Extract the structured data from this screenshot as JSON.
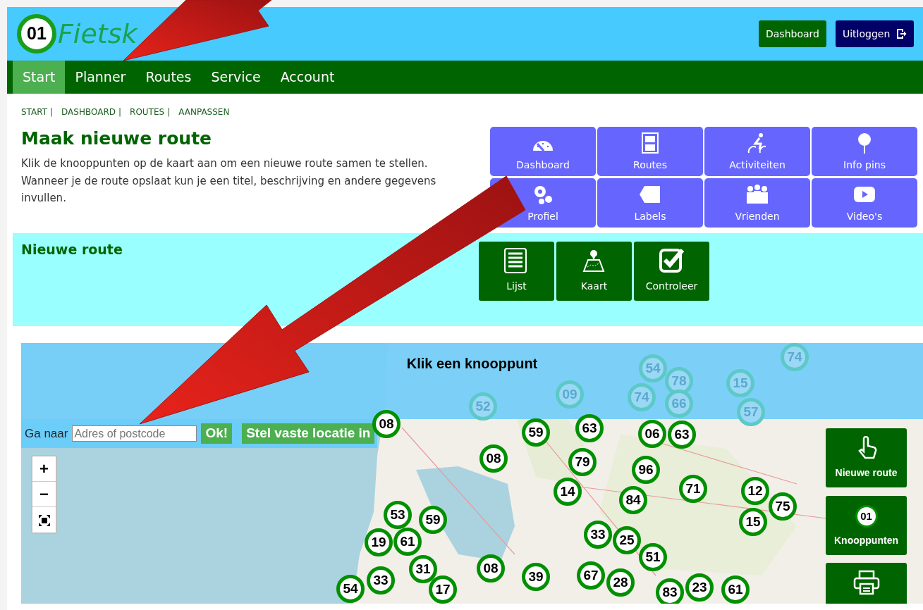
{
  "header": {
    "logo": {
      "badge": "01",
      "text": "Fietsk"
    },
    "buttons": [
      {
        "label": "Dashboard",
        "kind": "dashboard"
      },
      {
        "label": "Uitloggen",
        "kind": "logout"
      }
    ]
  },
  "nav": [
    {
      "label": "Start",
      "selected": true
    },
    {
      "label": "Planner",
      "selected": false
    },
    {
      "label": "Routes",
      "selected": false
    },
    {
      "label": "Service",
      "selected": false
    },
    {
      "label": "Account",
      "selected": false
    }
  ],
  "breadcrumb": {
    "items": [
      "START",
      "DASHBOARD",
      "ROUTES",
      "AANPASSEN"
    ],
    "separator": "|"
  },
  "title": "Maak nieuwe route",
  "intro": "Klik de knooppunten op de kaart aan om een nieuwe route samen te stellen. Wanneer je de route opslaat kun je een titel, beschrijving en andere gegevens invullen.",
  "tiles": [
    {
      "label": "Dashboard"
    },
    {
      "label": "Routes"
    },
    {
      "label": "Activiteiten"
    },
    {
      "label": "Info pins"
    },
    {
      "label": "Profiel"
    },
    {
      "label": "Labels"
    },
    {
      "label": "Vrienden"
    },
    {
      "label": "Video's"
    }
  ],
  "panel": {
    "title": "Nieuwe route",
    "buttons": [
      {
        "label": "Lijst"
      },
      {
        "label": "Kaart"
      },
      {
        "label": "Controleer"
      }
    ]
  },
  "map": {
    "title": "Klik een knooppunt",
    "search": {
      "label": "Ga naar",
      "placeholder": "Adres of postcode",
      "submit": "Ok!",
      "fixed_location": "Stel vaste locatie in"
    },
    "zoom": [
      "+",
      "−"
    ],
    "side_buttons": [
      {
        "label": "Nieuwe route"
      },
      {
        "label": "Knooppunten",
        "badge": "01"
      }
    ],
    "markers": [
      {
        "label": "54",
        "faded": true
      },
      {
        "label": "78",
        "faded": true
      },
      {
        "label": "15",
        "faded": true
      },
      {
        "label": "74",
        "faded": true
      },
      {
        "label": "52",
        "faded": true
      },
      {
        "label": "09",
        "faded": true
      },
      {
        "label": "74",
        "faded": true
      },
      {
        "label": "66",
        "faded": true
      },
      {
        "label": "57",
        "faded": true
      },
      {
        "label": "08",
        "faded": false
      },
      {
        "label": "59",
        "faded": false
      },
      {
        "label": "63",
        "faded": false
      },
      {
        "label": "06",
        "faded": false
      },
      {
        "label": "63",
        "faded": false
      },
      {
        "label": "08",
        "faded": false
      },
      {
        "label": "79",
        "faded": false
      },
      {
        "label": "96",
        "faded": false
      },
      {
        "label": "14",
        "faded": false
      },
      {
        "label": "84",
        "faded": false
      },
      {
        "label": "71",
        "faded": false
      },
      {
        "label": "12",
        "faded": false
      },
      {
        "label": "75",
        "faded": false
      },
      {
        "label": "53",
        "faded": false
      },
      {
        "label": "59",
        "faded": false
      },
      {
        "label": "15",
        "faded": false
      },
      {
        "label": "19",
        "faded": false
      },
      {
        "label": "61",
        "faded": false
      },
      {
        "label": "33",
        "faded": false
      },
      {
        "label": "25",
        "faded": false
      },
      {
        "label": "31",
        "faded": false
      },
      {
        "label": "08",
        "faded": false
      },
      {
        "label": "39",
        "faded": false
      },
      {
        "label": "67",
        "faded": false
      },
      {
        "label": "51",
        "faded": false
      },
      {
        "label": "54",
        "faded": false
      },
      {
        "label": "33",
        "faded": false
      },
      {
        "label": "17",
        "faded": false
      },
      {
        "label": "28",
        "faded": false
      },
      {
        "label": "83",
        "faded": false
      },
      {
        "label": "23",
        "faded": false
      },
      {
        "label": "61",
        "faded": false
      }
    ]
  }
}
